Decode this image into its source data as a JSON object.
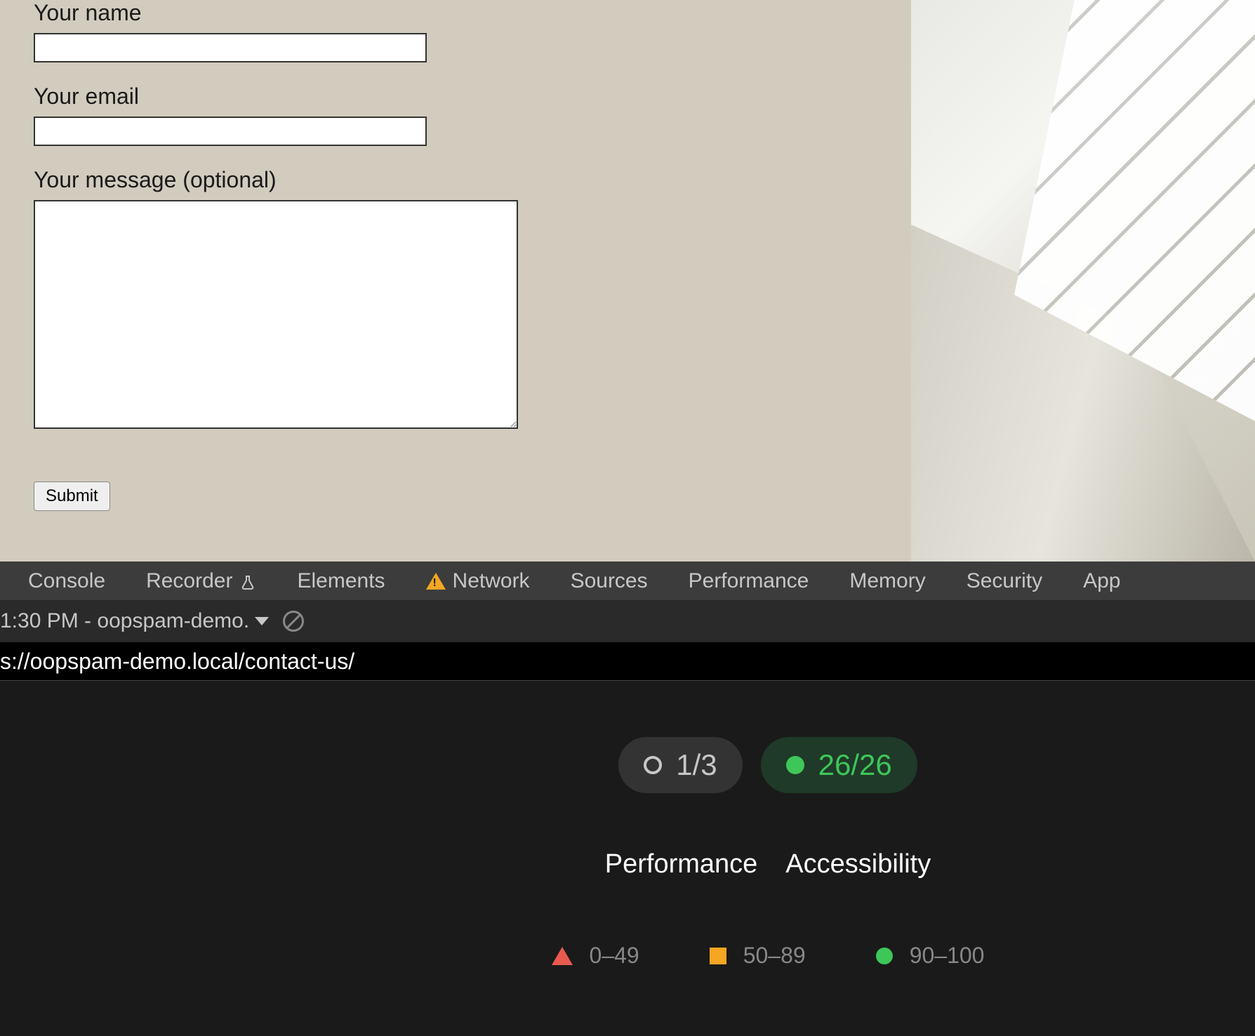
{
  "form": {
    "name_label": "Your name",
    "email_label": "Your email",
    "message_label": "Your message (optional)",
    "submit_label": "Submit"
  },
  "devtools": {
    "tabs": {
      "console": "Console",
      "recorder": "Recorder",
      "elements": "Elements",
      "network": "Network",
      "sources": "Sources",
      "performance": "Performance",
      "memory": "Memory",
      "security": "Security",
      "application": "App"
    },
    "toolbar": {
      "timestamp_label": "1:30 PM - oopspam-demo."
    },
    "url": "s://oopspam-demo.local/contact-us/"
  },
  "lighthouse": {
    "progress_ratio": "1/3",
    "passed_ratio": "26/26",
    "categories": {
      "performance": "Performance",
      "accessibility": "Accessibility"
    },
    "legend": {
      "red_range": "0–49",
      "orange_range": "50–89",
      "green_range": "90–100"
    }
  }
}
